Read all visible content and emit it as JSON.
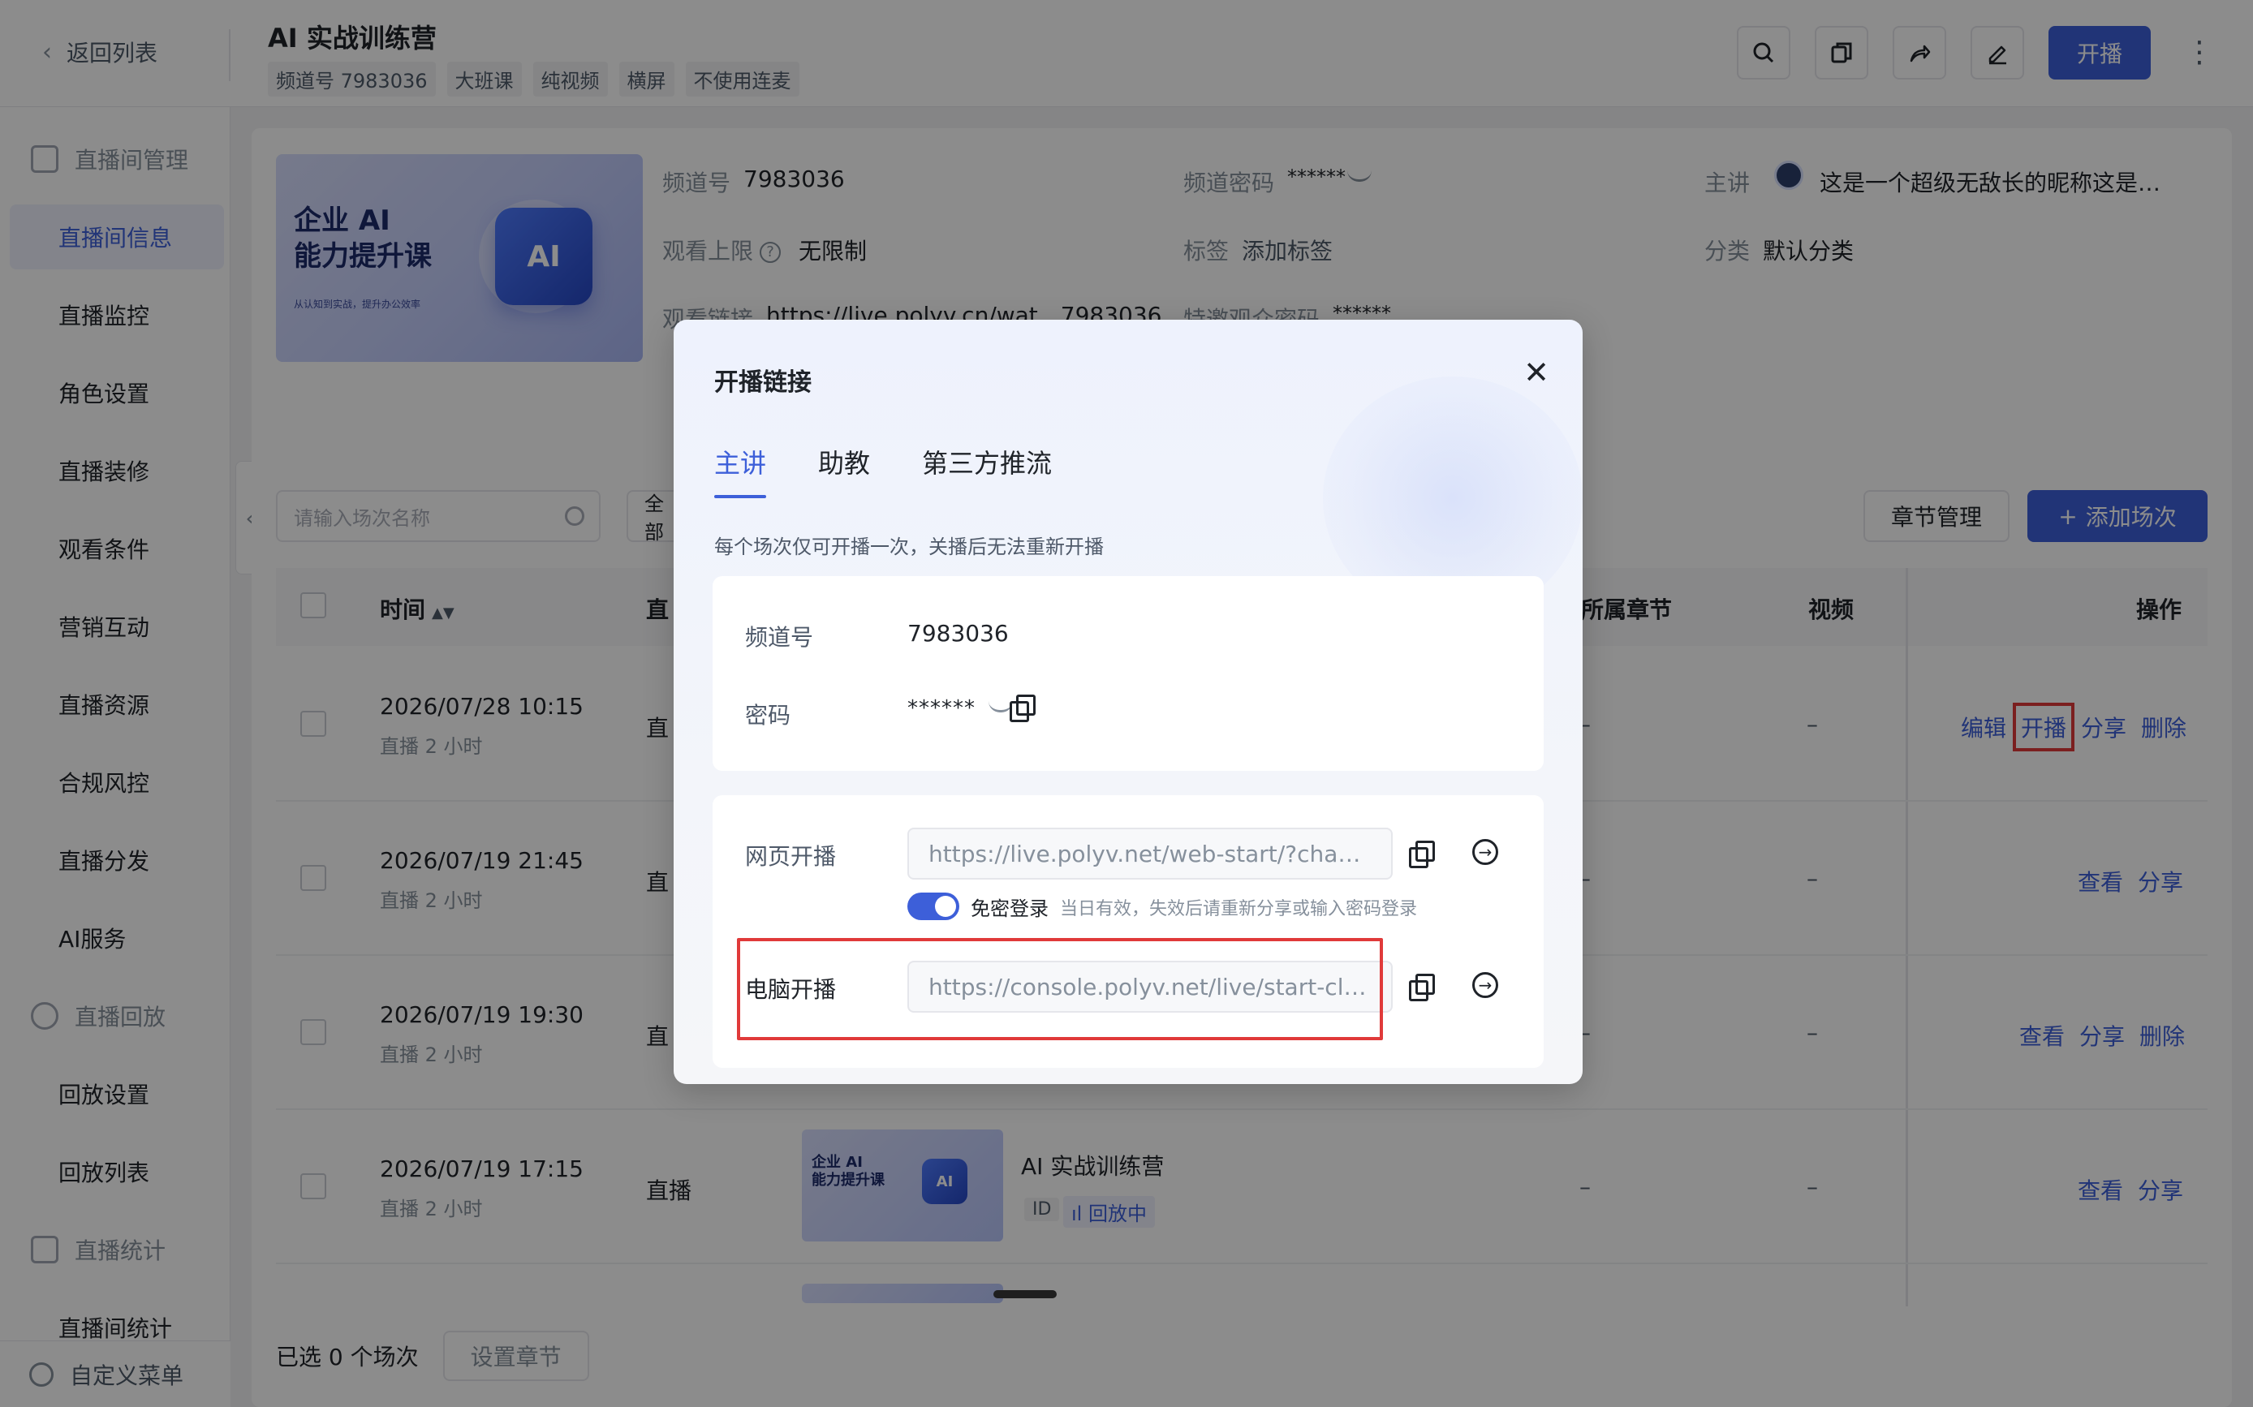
{
  "topbar": {
    "back_label": "返回列表",
    "title": "AI 实战训练营",
    "tags": [
      "频道号 7983036",
      "大班课",
      "纯视频",
      "横屏",
      "不使用连麦"
    ],
    "start_label": "开播",
    "more_label": "⋮"
  },
  "sidebar": {
    "items": [
      {
        "label": "直播间管理",
        "group": true,
        "icon": "play-square-icon"
      },
      {
        "label": "直播间信息",
        "active": true
      },
      {
        "label": "直播监控"
      },
      {
        "label": "角色设置"
      },
      {
        "label": "直播装修"
      },
      {
        "label": "观看条件"
      },
      {
        "label": "营销互动"
      },
      {
        "label": "直播资源"
      },
      {
        "label": "合规风控"
      },
      {
        "label": "直播分发"
      },
      {
        "label": "AI服务"
      },
      {
        "label": "直播回放",
        "group": true,
        "icon": "replay-icon"
      },
      {
        "label": "回放设置"
      },
      {
        "label": "回放列表"
      },
      {
        "label": "直播统计",
        "group": true,
        "icon": "chart-icon"
      },
      {
        "label": "直播间统计"
      }
    ],
    "footer_label": "自定义菜单"
  },
  "channel_info": {
    "cover_title_1": "企业 AI",
    "cover_title_2": "能力提升课",
    "cover_sub": "从认知到实战，提升办公效率",
    "cover_chip": "AI",
    "channel_no_label": "频道号",
    "channel_no": "7983036",
    "channel_pwd_label": "频道密码",
    "channel_pwd": "******",
    "host_label": "主讲",
    "host_name": "这是一个超级无敌长的昵称这是…",
    "limit_label": "观看上限",
    "limit_value": "无限制",
    "tag_label": "标签",
    "tag_value": "添加标签",
    "category_label": "分类",
    "category_value": "默认分类",
    "watch_link_label": "观看链接",
    "watch_link_value": "https://live.polyv.cn/wat…7983036",
    "guest_pwd_label": "特邀观众密码",
    "guest_pwd": "******"
  },
  "toolbar": {
    "search_placeholder": "请输入场次名称",
    "filter_label": "全部",
    "chapter_btn": "章节管理",
    "add_btn": "添加场次",
    "add_icon": "+"
  },
  "table": {
    "headers": {
      "time": "时间",
      "type": "直",
      "chapter": "所属章节",
      "video": "视频",
      "ops": "操作"
    },
    "sort_icon": "▲▼",
    "rows": [
      {
        "time": "2026/07/28 10:15",
        "sub": "直播 2 小时",
        "type": "直",
        "chapter": "–",
        "video": "–",
        "ops": [
          "编辑",
          "开播",
          "分享",
          "删除"
        ]
      },
      {
        "time": "2026/07/19 21:45",
        "sub": "直播 2 小时",
        "type": "直",
        "chapter": "–",
        "video": "–",
        "ops": [
          "查看",
          "分享"
        ]
      },
      {
        "time": "2026/07/19 19:30",
        "sub": "直播 2 小时",
        "type": "直",
        "chapter": "–",
        "video": "–",
        "ops": [
          "查看",
          "分享",
          "删除"
        ]
      },
      {
        "time": "2026/07/19 17:15",
        "sub": "直播 2 小时",
        "type": "直播",
        "chapter": "–",
        "video": "–",
        "ops": [
          "查看",
          "分享"
        ],
        "session_name": "AI 实战训练营",
        "id_tag": "ID",
        "status": "回放中"
      }
    ]
  },
  "bottom": {
    "selected_text": "已选 0 个场次",
    "set_chapter": "设置章节"
  },
  "modal": {
    "title": "开播链接",
    "close": "✕",
    "tabs": [
      "主讲",
      "助教",
      "第三方推流"
    ],
    "active_tab": 0,
    "note": "每个场次仅可开播一次，关播后无法重新开播",
    "channel_no_label": "频道号",
    "channel_no": "7983036",
    "password_label": "密码",
    "password_mask": "******",
    "web_label": "网页开播",
    "web_url": "https://live.polyv.net/web-start/?channell…",
    "toggle_label": "免密登录",
    "toggle_on": true,
    "toggle_hint": "当日有效，失效后请重新分享或输入密码登录",
    "pc_label": "电脑开播",
    "pc_url": "https://console.polyv.net/live/start-client.…",
    "goto_glyph": "→"
  }
}
